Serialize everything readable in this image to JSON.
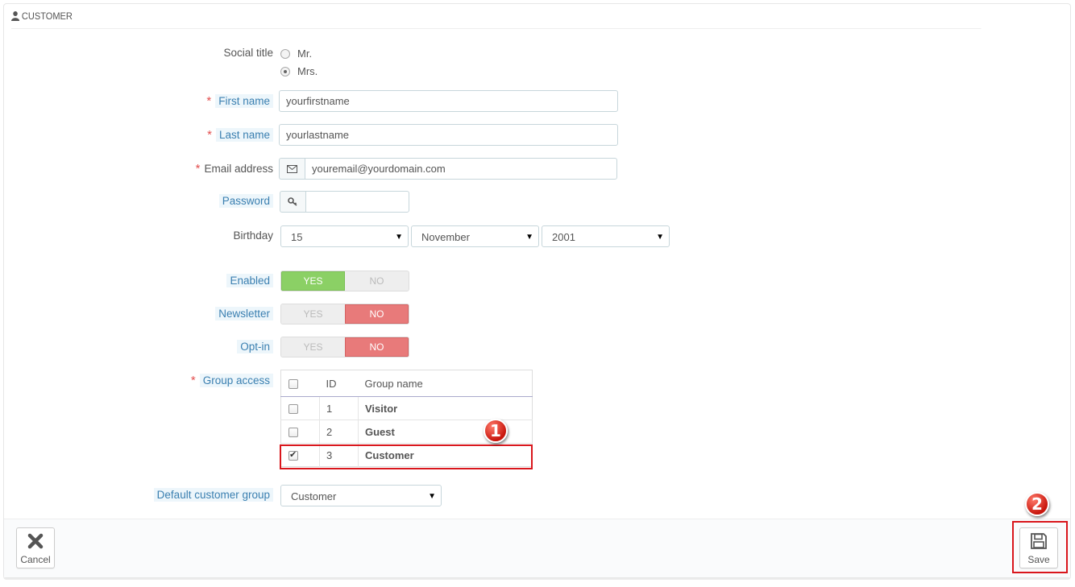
{
  "header": {
    "title": "CUSTOMER",
    "icon": "user-icon"
  },
  "form": {
    "social_title": {
      "label": "Social title",
      "options": [
        {
          "label": "Mr.",
          "checked": false
        },
        {
          "label": "Mrs.",
          "checked": true
        }
      ]
    },
    "first_name": {
      "label": "First name",
      "value": "yourfirstname",
      "required": "*"
    },
    "last_name": {
      "label": "Last name",
      "value": "yourlastname",
      "required": "*"
    },
    "email": {
      "label": "Email address",
      "value": "youremail@yourdomain.com",
      "required": "*",
      "icon": "envelope-icon"
    },
    "password": {
      "label": "Password",
      "value": "",
      "icon": "key-icon"
    },
    "birthday": {
      "label": "Birthday",
      "day": "15",
      "month": "November",
      "year": "2001"
    },
    "enabled": {
      "label": "Enabled",
      "yes": "YES",
      "no": "NO",
      "value": "YES"
    },
    "newsletter": {
      "label": "Newsletter",
      "yes": "YES",
      "no": "NO",
      "value": "NO"
    },
    "optin": {
      "label": "Opt-in",
      "yes": "YES",
      "no": "NO",
      "value": "NO"
    },
    "group_access": {
      "label": "Group access",
      "required": "*",
      "columns": {
        "id": "ID",
        "name": "Group name"
      },
      "rows": [
        {
          "id": "1",
          "name": "Visitor",
          "checked": false
        },
        {
          "id": "2",
          "name": "Guest",
          "checked": false
        },
        {
          "id": "3",
          "name": "Customer",
          "checked": true
        }
      ]
    },
    "default_group": {
      "label": "Default customer group",
      "value": "Customer"
    }
  },
  "footer": {
    "cancel_label": "Cancel",
    "save_label": "Save"
  },
  "annotations": {
    "step1": "1",
    "step2": "2",
    "highlight_color": "#d9161c"
  }
}
